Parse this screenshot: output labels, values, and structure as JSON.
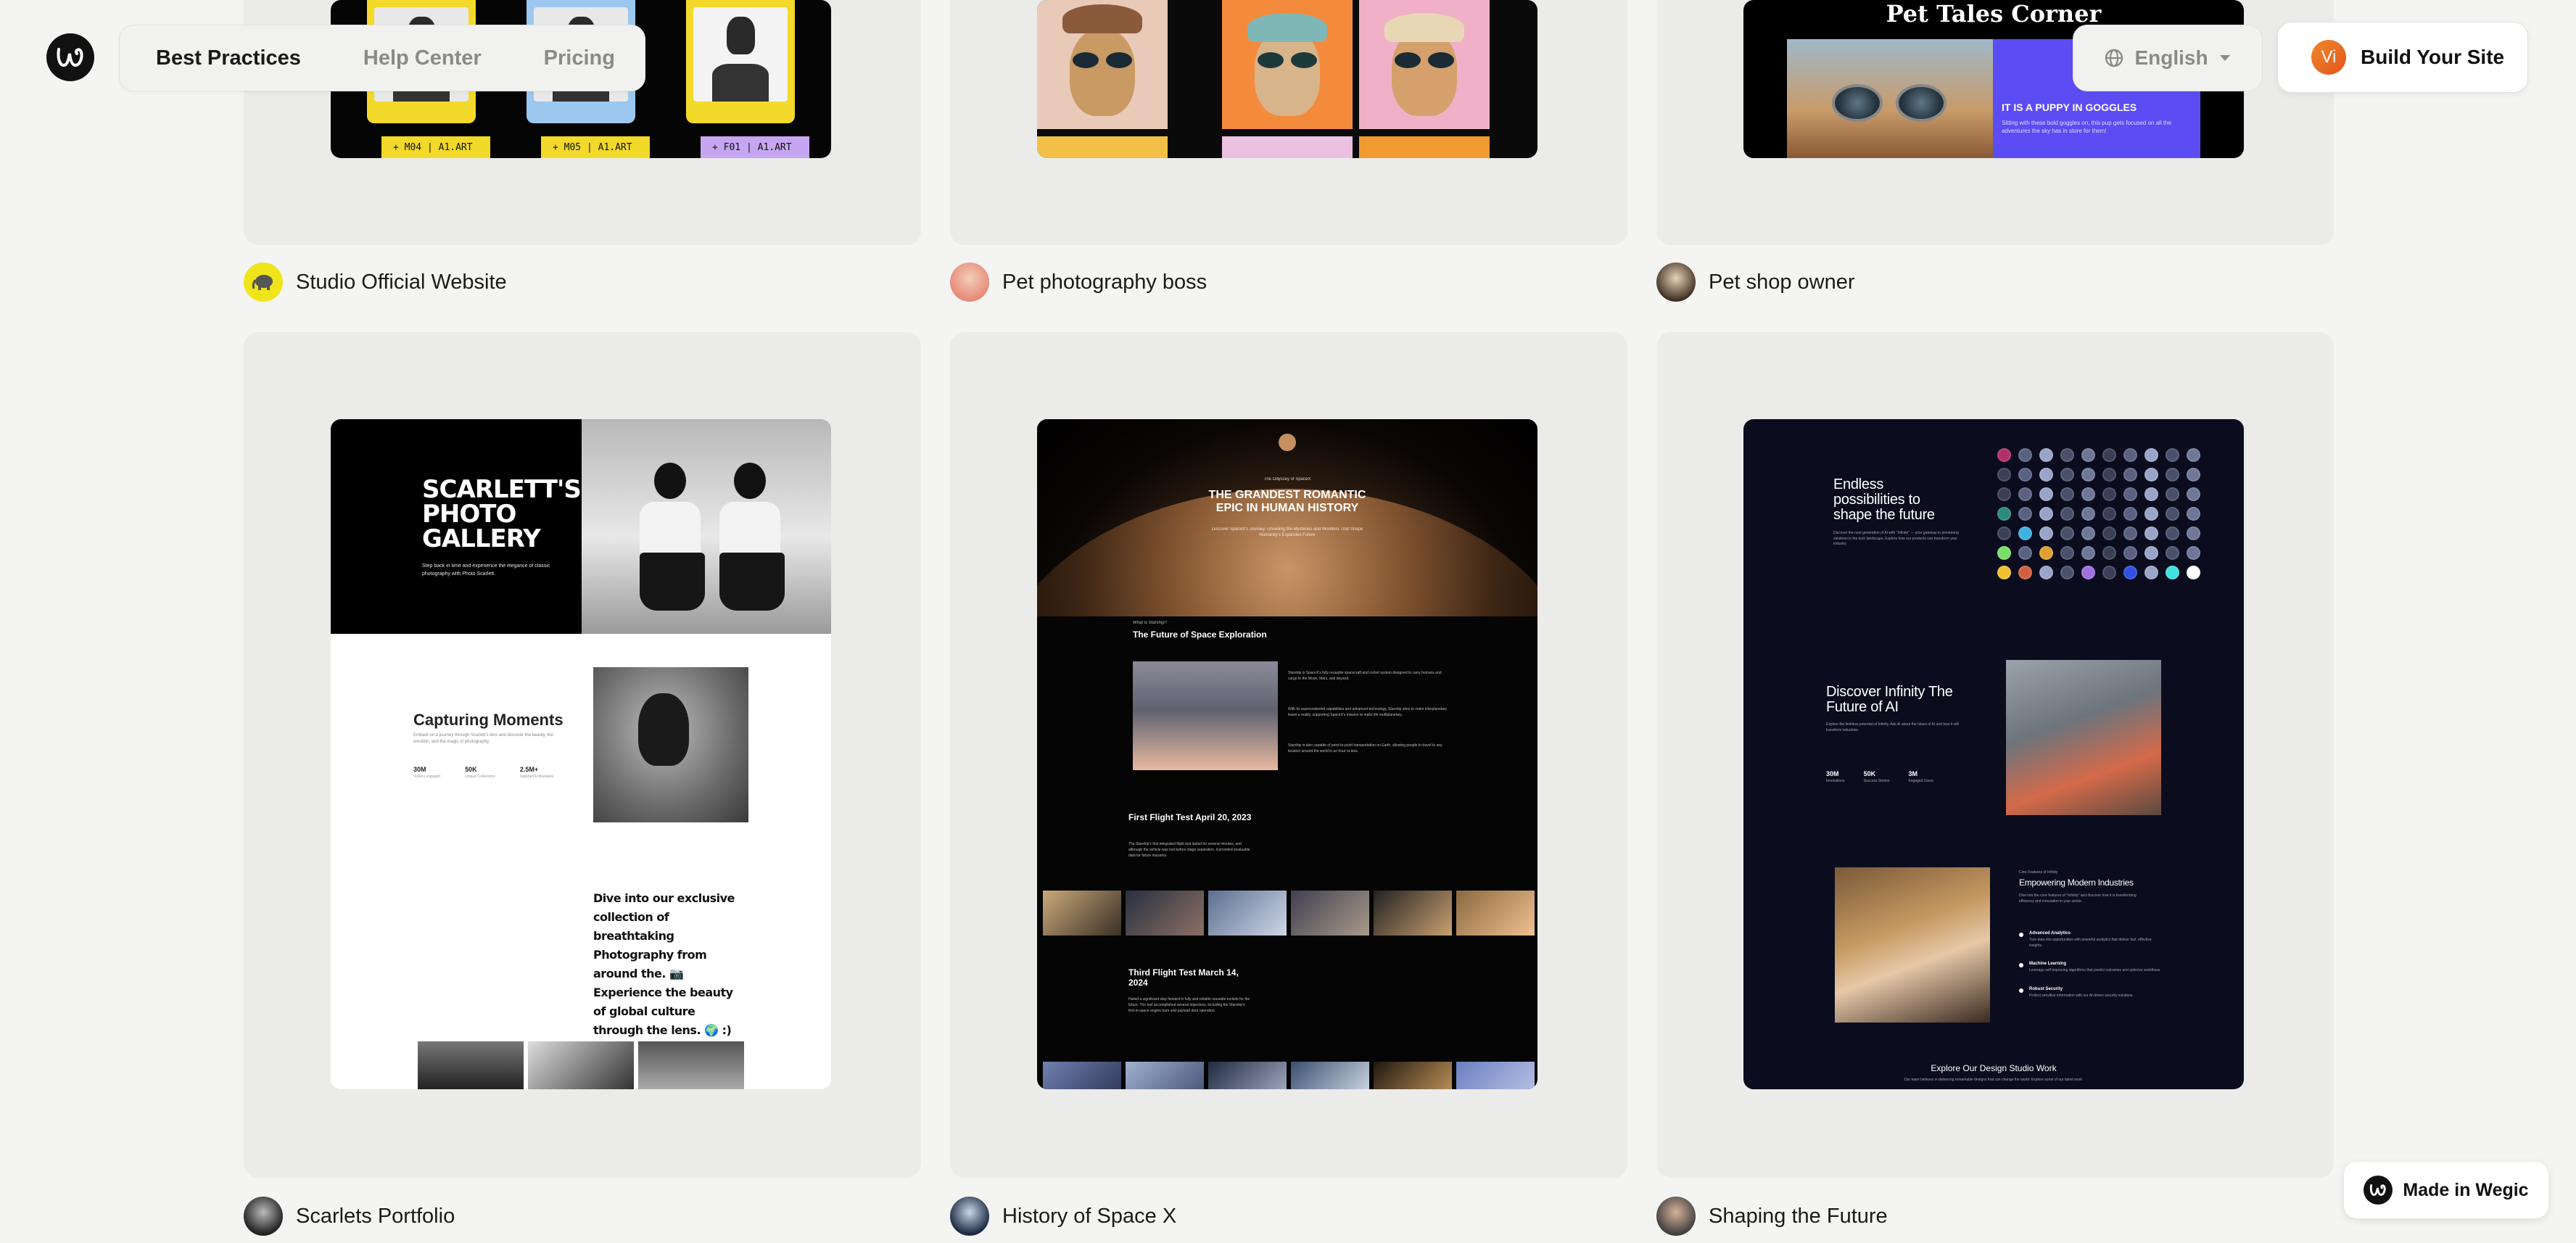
{
  "nav": {
    "links": [
      "Best Practices",
      "Help Center",
      "Pricing"
    ],
    "language": "English",
    "build_avatar": "Vi",
    "build_label": "Build Your Site"
  },
  "cards": [
    {
      "name": "Studio Official Website"
    },
    {
      "name": "Pet photography boss"
    },
    {
      "name": "Pet shop owner"
    },
    {
      "name": "Scarlets Portfolio"
    },
    {
      "name": "History of Space X"
    },
    {
      "name": "Shaping the Future"
    }
  ],
  "previews": {
    "studio": {
      "tags": [
        "+ M04 | A1.ART",
        "+ M05 | A1.ART",
        "+ F01 | A1.ART"
      ]
    },
    "tales": {
      "title": "Pet Tales Corner",
      "banner_title": "IT IS A PUPPY IN GOGGLES",
      "banner_text": "Sitting with these bold goggles on, this pup gets focused on all the adventures the sky has in store for them!"
    },
    "scarlett": {
      "title": "SCARLETT'S PHOTO GALLERY",
      "subtitle": "Step back in time and experience the elegance of classic photography with Photo Scarlett.",
      "capturing": "Capturing Moments",
      "capturing_sub": "Embark on a journey through Scarlett's lens and discover the beauty, the emotion, and the magic of photography.",
      "stats": [
        {
          "v": "30M",
          "l": "Visitors engaged"
        },
        {
          "v": "50K",
          "l": "Unique Collections"
        },
        {
          "v": "2.5M+",
          "l": "Satisfied Enthusiasts"
        }
      ],
      "quote": "Dive into our exclusive collection of breathtaking Photography from around the. 📷 Experience the beauty of global culture through the lens. 🌍 :)"
    },
    "space": {
      "kicker": "The Odyssey of SpaceX",
      "title": "THE GRANDEST ROMANTIC EPIC IN HUMAN HISTORY",
      "sub": "Discover SpaceX's Journey: Unveiling the Mysteries and Wonders That Shape Humanity's Expanded Future",
      "kicker2": "What is Starship?",
      "section": "The Future of Space Exploration",
      "para1": "Starship is SpaceX's fully reusable spacecraft and rocket system designed to carry humans and cargo to the Moon, Mars, and beyond.",
      "para2": "With its unprecedented capabilities and advanced technology, Starship aims to make interplanetary travel a reality, supporting SpaceX's mission to make life multiplanetary.",
      "para3": "Starship is also capable of point-to-point transportation on Earth, allowing people to travel to any location around the world in an hour or less.",
      "flight1": "First Flight Test April 20, 2023",
      "flight1_text": "The Starship's first integrated flight test lasted for several minutes, and although the vehicle was lost before stage separation, it provided invaluable data for future missions.",
      "flight2": "Third Flight Test March 14, 2024",
      "flight2_text": "Hailed a significant step forward in fully and reliable reusable rockets for the future. The test accomplished several objectives, including the Starship's first-in-space engine burn and payload door operation."
    },
    "ai": {
      "h1": "Endless possibilities to shape the future",
      "s1": "Discover the next generation of AI with \"Infinite\" — your gateway to pioneering solutions in the tech landscape. Explore how our products can transform your industry.",
      "h2": "Discover Infinity The Future of AI",
      "s2": "Explore the limitless potential of Infinity. Ask AI about the future of AI and how it will transform industries.",
      "stats": [
        {
          "v": "30M",
          "l": "Innovations"
        },
        {
          "v": "50K",
          "l": "Success Stories"
        },
        {
          "v": "3M",
          "l": "Engaged Users"
        }
      ],
      "kicker": "Core Features of Infinity",
      "h3": "Empowering Modern Industries",
      "s3": "Dive into the core features of \"Infinity\" and discover how it is transforming efficiency and innovation in your sector.",
      "features": [
        {
          "t": "Advanced Analytics",
          "d": "Turn data into opportunities with powerful analytics that deliver fast, effective insights."
        },
        {
          "t": "Machine Learning",
          "d": "Leverage self-improving algorithms that predict outcomes and optimize workflows."
        },
        {
          "t": "Robust Security",
          "d": "Protect sensitive information with our AI-driven security solutions."
        }
      ],
      "footer": "Explore Our Design Studio Work",
      "footer_sub": "Our team believes in delivering remarkable designs that can change the world. Explore some of our latest work."
    }
  },
  "badge": {
    "label": "Made in Wegic"
  },
  "colors": {
    "accent": "#e2541c",
    "tales_blue": "#5b4cf3",
    "card_bg": "#ebebe9",
    "page_bg": "#f4f4f2"
  }
}
